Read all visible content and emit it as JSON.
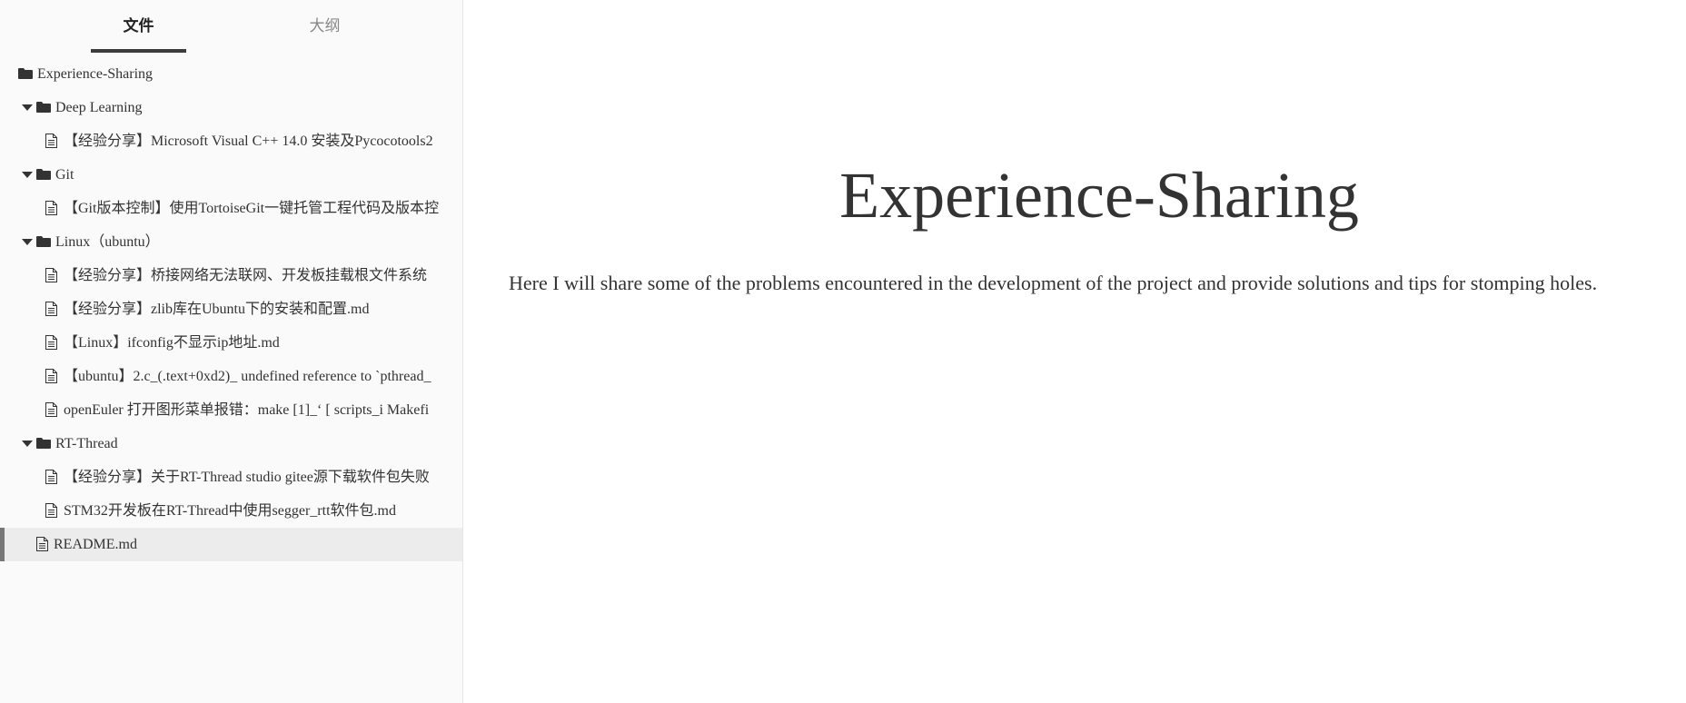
{
  "sidebar": {
    "tabs": {
      "files": "文件",
      "outline": "大纲"
    },
    "tree": {
      "root": "Experience-Sharing",
      "folders": [
        {
          "name": "Deep Learning",
          "files": [
            "【经验分享】Microsoft Visual C++ 14.0 安装及Pycocotools2"
          ]
        },
        {
          "name": "Git",
          "files": [
            "【Git版本控制】使用TortoiseGit一键托管工程代码及版本控"
          ]
        },
        {
          "name": "Linux（ubuntu）",
          "files": [
            "【经验分享】桥接网络无法联网、开发板挂载根文件系统",
            "【经验分享】zlib库在Ubuntu下的安装和配置.md",
            "【Linux】ifconfig不显示ip地址.md",
            "【ubuntu】2.c_(.text+0xd2)_ undefined reference to `pthread_",
            "openEuler 打开图形菜单报错：make [1]_‘ [ scripts_i Makefi"
          ]
        },
        {
          "name": "RT-Thread",
          "files": [
            "【经验分享】关于RT-Thread studio gitee源下载软件包失败",
            "STM32开发板在RT-Thread中使用segger_rtt软件包.md"
          ]
        }
      ],
      "readme": "README.md"
    }
  },
  "content": {
    "title": "Experience-Sharing",
    "description": "Here I will share some of the problems encountered in the development of the project and provide solutions and tips for stomping holes."
  }
}
